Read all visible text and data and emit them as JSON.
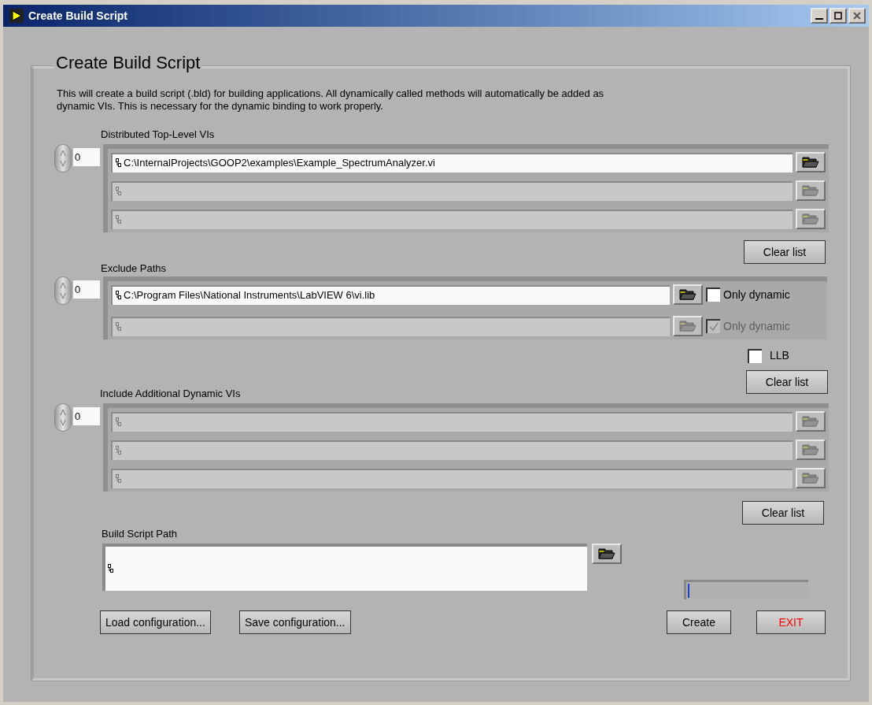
{
  "window": {
    "title": "Create Build Script"
  },
  "panel": {
    "title": "Create Build Script",
    "description": "This will create a build script (.bld) for building applications. All dynamically called methods will automatically be added as dynamic VIs. This is necessary for the dynamic binding to work properly."
  },
  "top_level_vis": {
    "label": "Distributed Top-Level VIs",
    "index": "0",
    "rows": [
      {
        "path": "C:\\InternalProjects\\GOOP2\\examples\\Example_SpectrumAnalyzer.vi",
        "disabled": false
      },
      {
        "disabled": true
      },
      {
        "disabled": true
      }
    ],
    "clear_button": "Clear list"
  },
  "exclude_paths": {
    "label": "Exclude Paths",
    "index": "0",
    "rows": [
      {
        "path": "C:\\Program Files\\National Instruments\\LabVIEW 6\\vi.lib",
        "disabled": false,
        "only_dynamic": {
          "label": "Only dynamic",
          "checked": false
        }
      },
      {
        "disabled": true,
        "only_dynamic": {
          "label": "Only dynamic",
          "checked": true
        }
      }
    ]
  },
  "llb": {
    "label": "LLB",
    "checked": false
  },
  "exclude_clear_button": "Clear list",
  "include_dynamic_vis": {
    "label": "Include Additional Dynamic VIs",
    "index": "0",
    "rows": [
      {
        "disabled": true
      },
      {
        "disabled": true
      },
      {
        "disabled": true
      }
    ],
    "clear_button": "Clear list"
  },
  "build_script_path": {
    "label": "Build Script Path"
  },
  "progress": {
    "level": 0
  },
  "buttons": [
    {
      "label": "Load configuration...",
      "kind": "normal"
    },
    {
      "label": "Save configuration...",
      "kind": "normal"
    },
    {
      "label": "Create",
      "kind": "normal"
    },
    {
      "label": "EXIT",
      "kind": "exit"
    }
  ]
}
